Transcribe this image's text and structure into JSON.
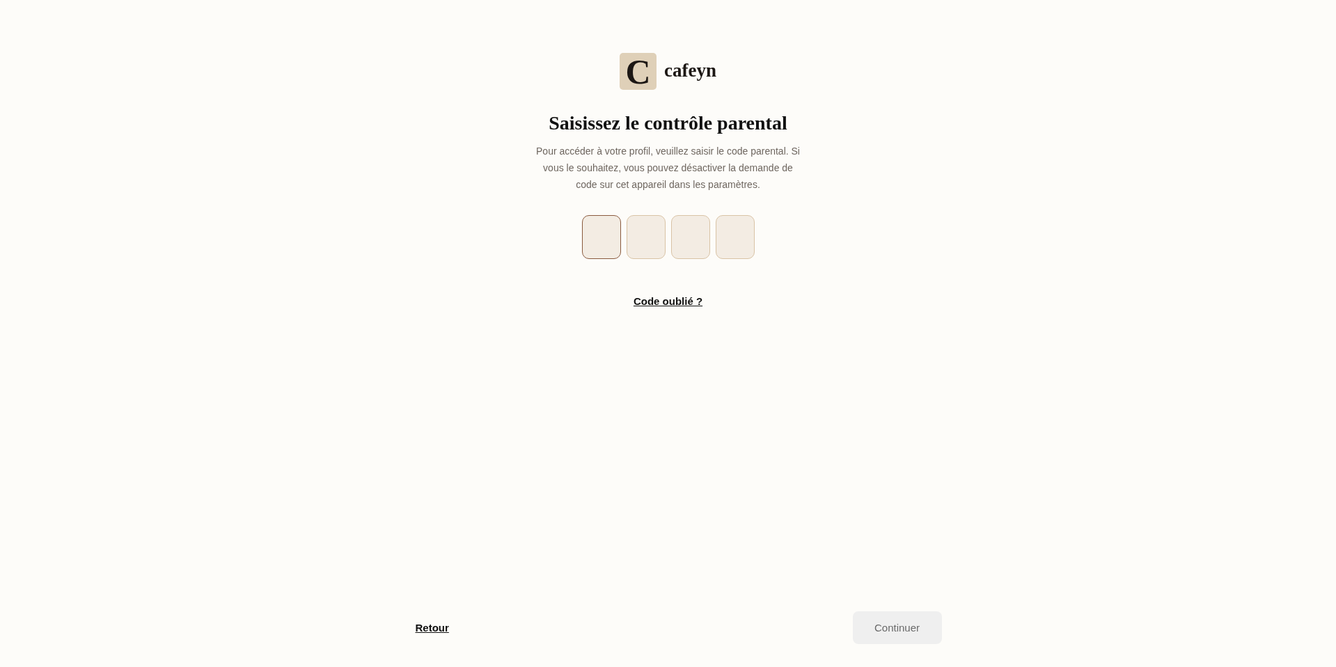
{
  "logo": {
    "mark": "C",
    "name": "cafeyn"
  },
  "title": "Saisissez le contrôle parental",
  "description": "Pour accéder à votre profil, veuillez saisir le code parental. Si vous le souhaitez, vous pouvez désactiver la demande de code sur cet appareil dans les paramètres.",
  "code_inputs": [
    {
      "selected": true
    },
    {
      "selected": false
    },
    {
      "selected": false
    },
    {
      "selected": false
    }
  ],
  "forgot_link": "Code oublié ?",
  "footer": {
    "back_link": "Retour",
    "continue_button": {
      "label": "Continuer",
      "disabled": true
    }
  }
}
